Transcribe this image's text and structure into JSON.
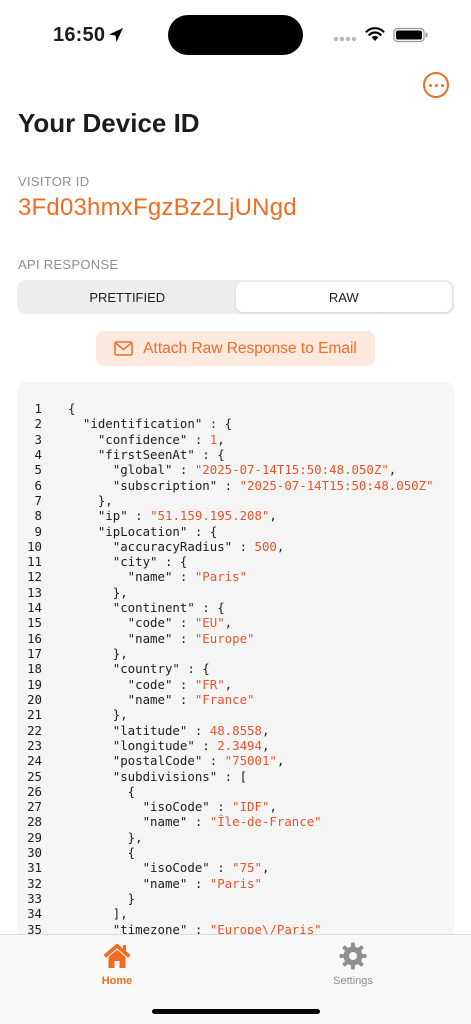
{
  "status_bar": {
    "time": "16:50"
  },
  "header": {
    "title": "Your Device ID",
    "more_icon": "ellipsis-circle-icon"
  },
  "visitor": {
    "label": "VISITOR ID",
    "id": "3Fd03hmxFgzBz2LjUNgd"
  },
  "api": {
    "label": "API RESPONSE",
    "tabs": [
      "PRETTIFIED",
      "RAW"
    ],
    "selected_tab": "RAW",
    "attach_label": "Attach Raw Response to Email",
    "attach_icon": "envelope-icon"
  },
  "code": [
    {
      "n": "1",
      "t": [
        [
          "p",
          "{"
        ]
      ]
    },
    {
      "n": "2",
      "t": [
        [
          "p",
          "  \"identification\" : {"
        ]
      ]
    },
    {
      "n": "3",
      "t": [
        [
          "p",
          "    \"confidence\" : "
        ],
        [
          "n",
          "1"
        ],
        [
          "p",
          ","
        ]
      ]
    },
    {
      "n": "4",
      "t": [
        [
          "p",
          "    \"firstSeenAt\" : {"
        ]
      ]
    },
    {
      "n": "5",
      "t": [
        [
          "p",
          "      \"global\" : "
        ],
        [
          "s",
          "\"2025-07-14T15:50:48.050Z\""
        ],
        [
          "p",
          ","
        ]
      ]
    },
    {
      "n": "6",
      "t": [
        [
          "p",
          "      \"subscription\" : "
        ],
        [
          "s",
          "\"2025-07-14T15:50:48.050Z\""
        ]
      ]
    },
    {
      "n": "7",
      "t": [
        [
          "p",
          "    },"
        ]
      ]
    },
    {
      "n": "8",
      "t": [
        [
          "p",
          "    \"ip\" : "
        ],
        [
          "s",
          "\"51.159.195.208\""
        ],
        [
          "p",
          ","
        ]
      ]
    },
    {
      "n": "9",
      "t": [
        [
          "p",
          "    \"ipLocation\" : {"
        ]
      ]
    },
    {
      "n": "10",
      "t": [
        [
          "p",
          "      \"accuracyRadius\" : "
        ],
        [
          "n",
          "500"
        ],
        [
          "p",
          ","
        ]
      ]
    },
    {
      "n": "11",
      "t": [
        [
          "p",
          "      \"city\" : {"
        ]
      ]
    },
    {
      "n": "12",
      "t": [
        [
          "p",
          "        \"name\" : "
        ],
        [
          "s",
          "\"Paris\""
        ]
      ]
    },
    {
      "n": "13",
      "t": [
        [
          "p",
          "      },"
        ]
      ]
    },
    {
      "n": "14",
      "t": [
        [
          "p",
          "      \"continent\" : {"
        ]
      ]
    },
    {
      "n": "15",
      "t": [
        [
          "p",
          "        \"code\" : "
        ],
        [
          "s",
          "\"EU\""
        ],
        [
          "p",
          ","
        ]
      ]
    },
    {
      "n": "16",
      "t": [
        [
          "p",
          "        \"name\" : "
        ],
        [
          "s",
          "\"Europe\""
        ]
      ]
    },
    {
      "n": "17",
      "t": [
        [
          "p",
          "      },"
        ]
      ]
    },
    {
      "n": "18",
      "t": [
        [
          "p",
          "      \"country\" : {"
        ]
      ]
    },
    {
      "n": "19",
      "t": [
        [
          "p",
          "        \"code\" : "
        ],
        [
          "s",
          "\"FR\""
        ],
        [
          "p",
          ","
        ]
      ]
    },
    {
      "n": "20",
      "t": [
        [
          "p",
          "        \"name\" : "
        ],
        [
          "s",
          "\"France\""
        ]
      ]
    },
    {
      "n": "21",
      "t": [
        [
          "p",
          "      },"
        ]
      ]
    },
    {
      "n": "22",
      "t": [
        [
          "p",
          "      \"latitude\" : "
        ],
        [
          "n",
          "48.8558"
        ],
        [
          "p",
          ","
        ]
      ]
    },
    {
      "n": "23",
      "t": [
        [
          "p",
          "      \"longitude\" : "
        ],
        [
          "n",
          "2.3494"
        ],
        [
          "p",
          ","
        ]
      ]
    },
    {
      "n": "24",
      "t": [
        [
          "p",
          "      \"postalCode\" : "
        ],
        [
          "s",
          "\"75001\""
        ],
        [
          "p",
          ","
        ]
      ]
    },
    {
      "n": "25",
      "t": [
        [
          "p",
          "      \"subdivisions\" : ["
        ]
      ]
    },
    {
      "n": "26",
      "t": [
        [
          "p",
          "        {"
        ]
      ]
    },
    {
      "n": "27",
      "t": [
        [
          "p",
          "          \"isoCode\" : "
        ],
        [
          "s",
          "\"IDF\""
        ],
        [
          "p",
          ","
        ]
      ]
    },
    {
      "n": "28",
      "t": [
        [
          "p",
          "          \"name\" : "
        ],
        [
          "s",
          "\"Île-de-France\""
        ]
      ]
    },
    {
      "n": "29",
      "t": [
        [
          "p",
          "        },"
        ]
      ]
    },
    {
      "n": "30",
      "t": [
        [
          "p",
          "        {"
        ]
      ]
    },
    {
      "n": "31",
      "t": [
        [
          "p",
          "          \"isoCode\" : "
        ],
        [
          "s",
          "\"75\""
        ],
        [
          "p",
          ","
        ]
      ]
    },
    {
      "n": "32",
      "t": [
        [
          "p",
          "          \"name\" : "
        ],
        [
          "s",
          "\"Paris\""
        ]
      ]
    },
    {
      "n": "33",
      "t": [
        [
          "p",
          "        }"
        ]
      ]
    },
    {
      "n": "34",
      "t": [
        [
          "p",
          "      ],"
        ]
      ]
    },
    {
      "n": "35",
      "t": [
        [
          "p",
          "      \"timezone\" : "
        ],
        [
          "s",
          "\"Europe\\/Paris\""
        ]
      ]
    }
  ],
  "tab_bar": {
    "items": [
      {
        "label": "Home",
        "icon": "house-icon",
        "active": true
      },
      {
        "label": "Settings",
        "icon": "gear-icon",
        "active": false
      }
    ]
  },
  "colors": {
    "accent": "#f26b21",
    "accent_bg": "#fde9de"
  }
}
